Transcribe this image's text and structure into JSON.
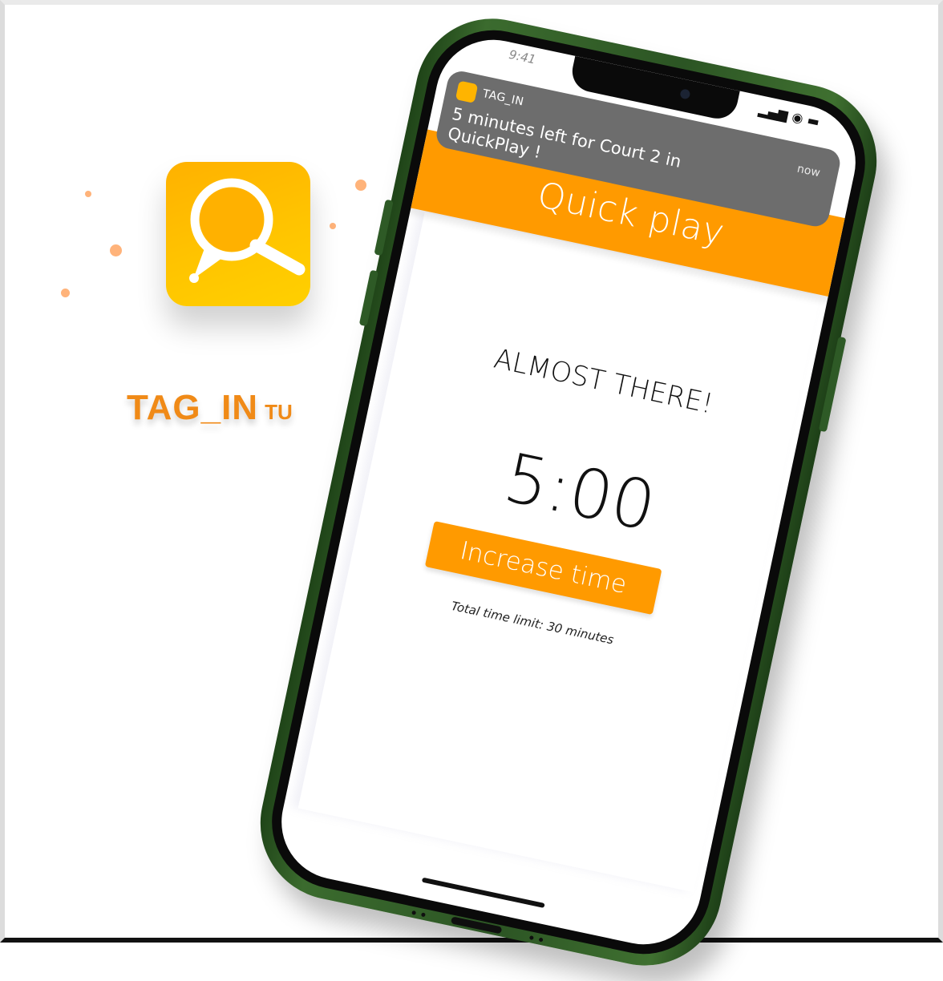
{
  "brand": {
    "name": "TAG_IN",
    "suffix": "TU",
    "accent_color": "#f08a17",
    "icon": "magnifier-pin-icon"
  },
  "status_bar": {
    "time": "9:41",
    "icons": "signal-wifi-battery-icons"
  },
  "notification": {
    "app_name": "TAG_IN",
    "time": "now",
    "message": "5 minutes left for Court 2 in QuickPlay !"
  },
  "screen": {
    "header_title": "Quick play",
    "status_heading": "ALMOST THERE!",
    "timer": "5:00",
    "increase_button": "Increase time",
    "time_limit_text": "Total time limit: 30 minutes",
    "primary_color": "#ff9a00"
  }
}
